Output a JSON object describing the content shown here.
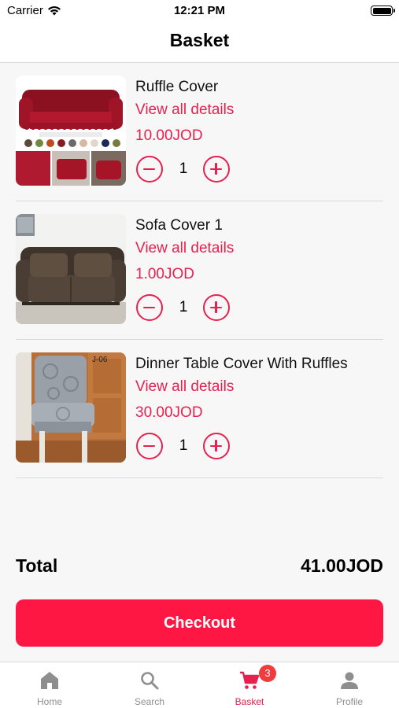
{
  "status_bar": {
    "carrier": "Carrier",
    "time": "12:21 PM"
  },
  "header": {
    "title": "Basket"
  },
  "cart": {
    "items": [
      {
        "name": "Ruffle Cover",
        "details_label": "View all details",
        "price": "10.00JOD",
        "quantity": "1",
        "thumbnail": "red-ruffle-sofa-cover-image"
      },
      {
        "name": "Sofa Cover 1",
        "details_label": "View all details",
        "price": "1.00JOD",
        "quantity": "1",
        "thumbnail": "brown-sofa-cover-image"
      },
      {
        "name": "Dinner Table Cover With Ruffles",
        "details_label": "View all details",
        "price": "30.00JOD",
        "quantity": "1",
        "thumbnail": "grey-chair-cover-image",
        "thumbnail_text": "J-06"
      }
    ]
  },
  "summary": {
    "total_label": "Total",
    "total_value": "41.00JOD",
    "checkout_label": "Checkout"
  },
  "tab_bar": {
    "tabs": [
      {
        "label": "Home",
        "icon": "home-icon",
        "active": false
      },
      {
        "label": "Search",
        "icon": "search-icon",
        "active": false
      },
      {
        "label": "Basket",
        "icon": "cart-icon",
        "active": true,
        "badge": "3"
      },
      {
        "label": "Profile",
        "icon": "person-icon",
        "active": false
      }
    ]
  },
  "colors": {
    "accent": "#e8204f",
    "checkout_button": "#ff1744",
    "badge": "#f03c3c",
    "inactive_tab": "#8e8e8e"
  }
}
